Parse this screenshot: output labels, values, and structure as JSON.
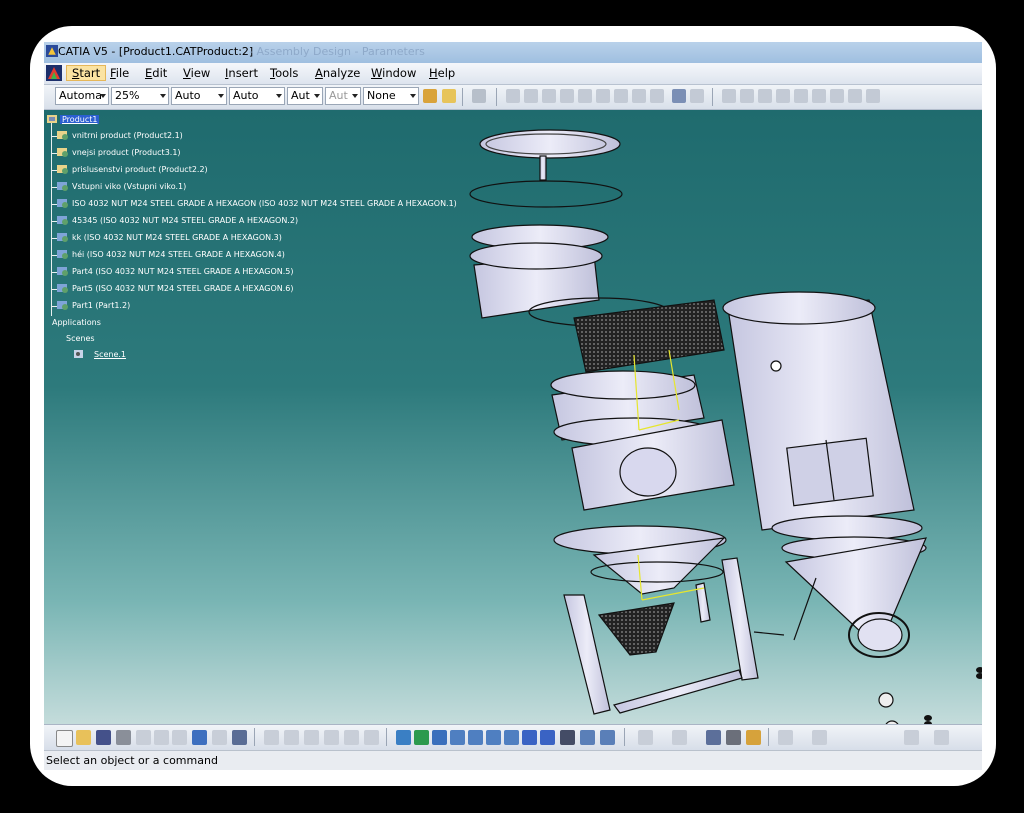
{
  "window": {
    "title": "CATIA V5 - [Product1.CATProduct:2]",
    "title_ghost": "- Assembly Design - Parameters"
  },
  "menu": {
    "items": [
      "Start",
      "File",
      "Edit",
      "View",
      "Insert",
      "Tools",
      "Analyze",
      "Window",
      "Help"
    ]
  },
  "toolbar": {
    "combos": [
      "Automa",
      "25%",
      "Auto",
      "Auto",
      "Aut",
      "Aut",
      "None"
    ]
  },
  "tree": {
    "root": "Product1",
    "items": [
      "vnitrni product (Product2.1)",
      "vnejsi product (Product3.1)",
      "prislusenstvi product (Product2.2)",
      "Vstupni viko (Vstupni viko.1)",
      "ISO 4032 NUT M24 STEEL GRADE A HEXAGON (ISO 4032 NUT M24 STEEL GRADE A HEXAGON.1)",
      "45345 (ISO 4032 NUT M24 STEEL GRADE A HEXAGON.2)",
      "kk (ISO 4032 NUT M24 STEEL GRADE A HEXAGON.3)",
      "héi (ISO 4032 NUT M24 STEEL GRADE A HEXAGON.4)",
      "Part4 (ISO 4032 NUT M24 STEEL GRADE A HEXAGON.5)",
      "Part5 (ISO 4032 NUT M24 STEEL GRADE A HEXAGON.6)",
      "Part1 (Part1.2)"
    ],
    "applications": "Applications",
    "scenes": "Scenes",
    "scene": "Scene.1"
  },
  "status": {
    "text": "Select an object or a command"
  },
  "colors": {
    "background_top": "#1f6b6e",
    "background_bottom": "#c4dcdb",
    "part_fill": "#d9d9ee",
    "selection": "#2b5fd0"
  }
}
